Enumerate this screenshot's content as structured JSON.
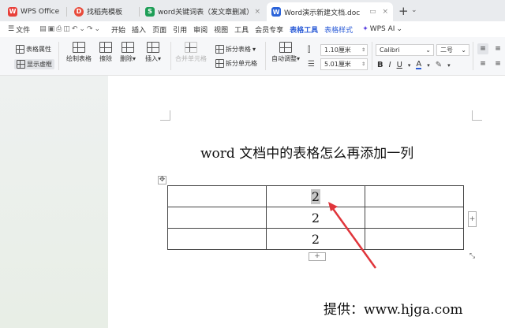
{
  "tabs": [
    {
      "label": "WPS Office",
      "icon": "wps-logo-icon",
      "color": "#e8403a"
    },
    {
      "label": "找稻壳模板",
      "icon": "docer-icon",
      "color": "#e84a3a"
    },
    {
      "label": "word关键词表（发文章删减）.xlsx",
      "icon": "sheet-icon",
      "color": "#1e9e57",
      "icon_text": "S"
    },
    {
      "label": "Word演示新建文档.doc",
      "icon": "word-icon",
      "color": "#2b63d9",
      "icon_text": "W"
    }
  ],
  "menu": {
    "file": "文件",
    "items": [
      "开始",
      "插入",
      "页面",
      "引用",
      "审阅",
      "视图",
      "工具",
      "会员专享",
      "表格工具",
      "表格样式"
    ],
    "active": "表格工具",
    "wps_ai": "WPS AI"
  },
  "ribbon": {
    "table_props": "表格属性",
    "show_gridlines": "显示虚框",
    "draw_table": "绘制表格",
    "erase": "擦除",
    "delete": "删除",
    "insert": "插入",
    "merge_cells": "合并单元格",
    "split_table": "拆分表格",
    "split_cells": "拆分单元格",
    "auto_fit": "自动调整",
    "height_value": "1.10厘米",
    "width_value": "5.01厘米",
    "font_name": "Calibri",
    "font_size": "二号"
  },
  "document": {
    "heading": "word 文档中的表格怎么再添加一列",
    "table": [
      [
        "",
        "2",
        ""
      ],
      [
        "",
        "2",
        ""
      ],
      [
        "",
        "2",
        ""
      ]
    ],
    "footer": "提供：www.hjga.com"
  },
  "colors": {
    "accent": "#2a5bd7",
    "arrow": "#e0353b"
  }
}
